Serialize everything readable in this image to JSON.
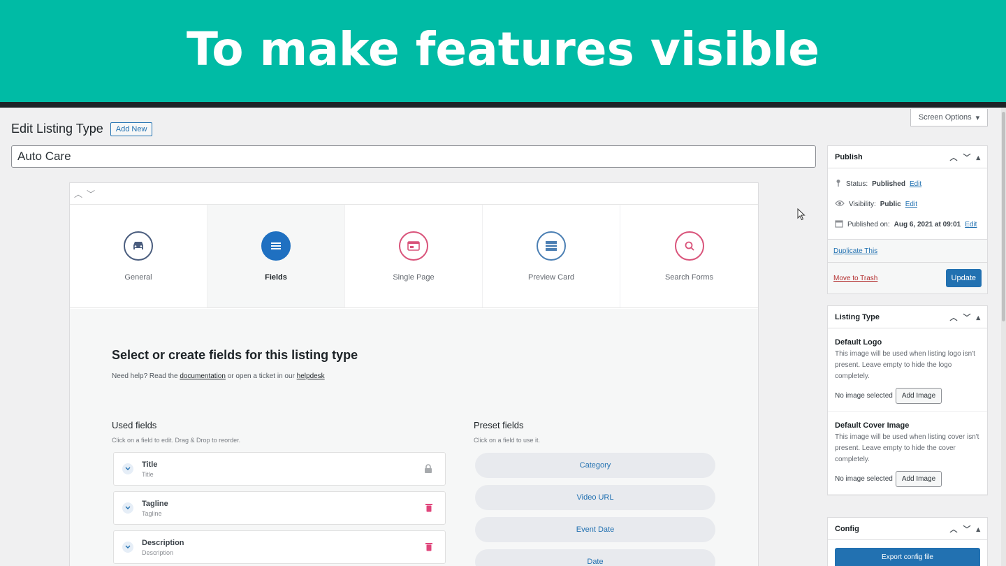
{
  "banner": {
    "title": "To make features visible"
  },
  "screen_options": {
    "label": "Screen Options"
  },
  "page": {
    "title": "Edit Listing Type",
    "add_new": "Add New",
    "post_title_value": "Auto Care"
  },
  "tabs": [
    {
      "label": "General",
      "icon": "car-icon",
      "color": "#4a5d7e"
    },
    {
      "label": "Fields",
      "icon": "list-icon",
      "color": "#1f70c1"
    },
    {
      "label": "Single Page",
      "icon": "browser-icon",
      "color": "#d9537a"
    },
    {
      "label": "Preview Card",
      "icon": "card-icon",
      "color": "#4b7fb3"
    },
    {
      "label": "Search Forms",
      "icon": "search-icon",
      "color": "#d9537a"
    }
  ],
  "fields_panel": {
    "heading": "Select or create fields for this listing type",
    "help_prefix": "Need help? Read the",
    "help_doc_link": "documentation",
    "help_middle": "or open a ticket in our",
    "help_desk_link": "helpdesk",
    "used_title": "Used fields",
    "used_sub": "Click on a field to edit. Drag & Drop to reorder.",
    "preset_title": "Preset fields",
    "preset_sub": "Click on a field to use it.",
    "used_fields": [
      {
        "name": "Title",
        "sub": "Title",
        "action": "lock-icon"
      },
      {
        "name": "Tagline",
        "sub": "Tagline",
        "action": "trash-icon"
      },
      {
        "name": "Description",
        "sub": "Description",
        "action": "trash-icon"
      }
    ],
    "preset_fields": [
      "Category",
      "Video URL",
      "Event Date",
      "Date"
    ]
  },
  "publish": {
    "title": "Publish",
    "status_label": "Status:",
    "status_value": "Published",
    "visibility_label": "Visibility:",
    "visibility_value": "Public",
    "published_label": "Published on:",
    "published_value": "Aug 6, 2021 at 09:01",
    "edit": "Edit",
    "duplicate": "Duplicate This",
    "trash": "Move to Trash",
    "update": "Update"
  },
  "listing_type": {
    "title": "Listing Type",
    "logo_title": "Default Logo",
    "logo_desc": "This image will be used when listing logo isn't present. Leave empty to hide the logo completely.",
    "cover_title": "Default Cover Image",
    "cover_desc": "This image will be used when listing cover isn't present. Leave empty to hide the cover completely.",
    "no_image": "No image selected",
    "add_image": "Add Image"
  },
  "config": {
    "title": "Config",
    "export": "Export config file"
  }
}
